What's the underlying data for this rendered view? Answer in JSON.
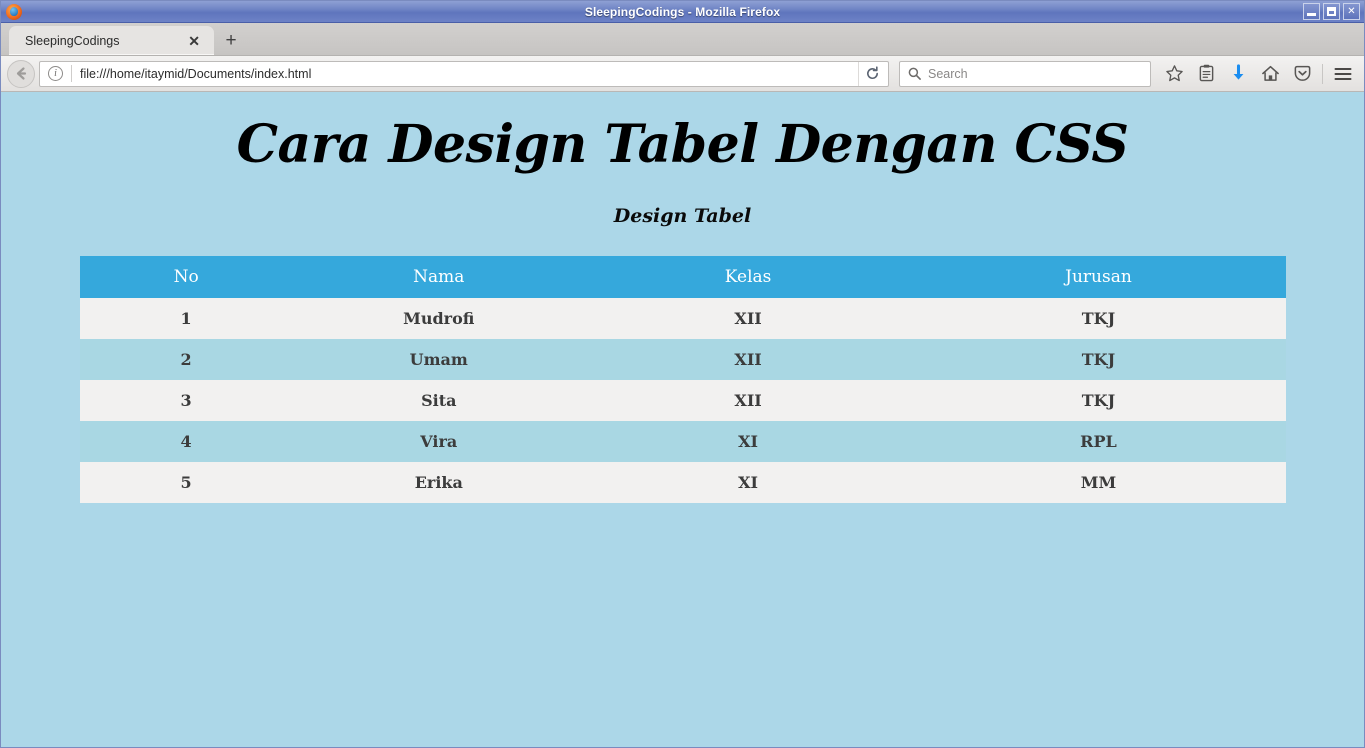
{
  "window": {
    "title": "SleepingCodings - Mozilla Firefox",
    "app_icon": "firefox-icon",
    "controls": {
      "minimize_label": "Minimize",
      "maximize_label": "Maximize",
      "close_label": "✕"
    }
  },
  "tabs": {
    "items": [
      {
        "label": "SleepingCodings",
        "close_label": "✕"
      }
    ],
    "new_tab_label": "+"
  },
  "toolbar": {
    "back_label": "Back",
    "url_value": "file:///home/itaymid/Documents/index.html",
    "site_info_label": "i",
    "reload_label": "Reload",
    "search_placeholder": "Search",
    "icons": [
      {
        "name": "bookmark-star-icon"
      },
      {
        "name": "library-icon"
      },
      {
        "name": "download-arrow-icon"
      },
      {
        "name": "home-icon"
      },
      {
        "name": "pocket-icon"
      },
      {
        "name": "hamburger-menu-icon"
      }
    ]
  },
  "content": {
    "heading": "Cara Design Tabel Dengan CSS",
    "subheading": "Design Tabel",
    "colors": {
      "page_background": "#acd7e8",
      "table_header": "#35a8dc",
      "row_odd": "#f2f1f0",
      "row_even": "#a9d7e3",
      "header_text": "#ffffff",
      "cell_text": "#3c3c3c"
    },
    "table": {
      "columns": [
        "No",
        "Nama",
        "Kelas",
        "Jurusan"
      ],
      "rows": [
        [
          "1",
          "Mudrofi",
          "XII",
          "TKJ"
        ],
        [
          "2",
          "Umam",
          "XII",
          "TKJ"
        ],
        [
          "3",
          "Sita",
          "XII",
          "TKJ"
        ],
        [
          "4",
          "Vira",
          "XI",
          "RPL"
        ],
        [
          "5",
          "Erika",
          "XI",
          "MM"
        ]
      ]
    }
  }
}
